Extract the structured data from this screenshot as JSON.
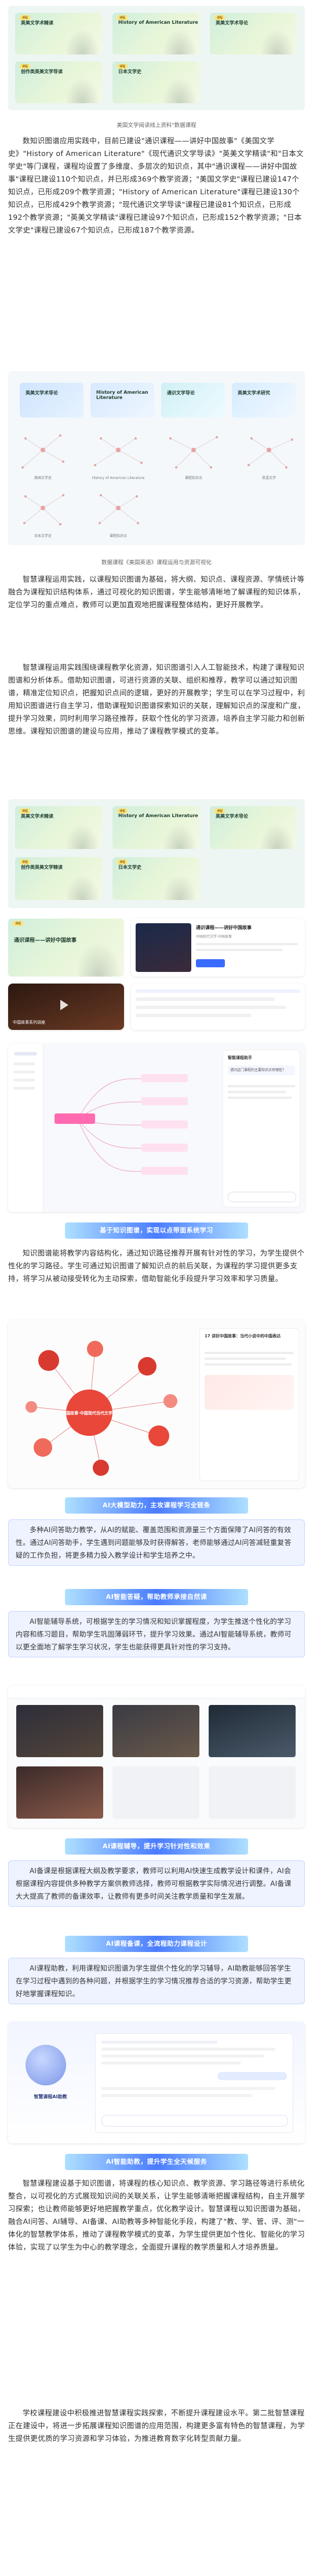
{
  "captions": {
    "c1": "美国文学阅读线上资料\"数据课程",
    "c2": "数据课程《美国英语》课程运用与资源可视化"
  },
  "tiles": {
    "grid1": [
      "英美文学术精读",
      "History of American Literature",
      "英美文学术导论",
      "创作类英美文学导读",
      "日本文学史"
    ],
    "grid2": [
      "英美文学术导论",
      "History of American Literature",
      "通识文学导论",
      "英美文学术研究"
    ],
    "grid3": [
      "英美文学术精读",
      "History of American Literature",
      "英美文学术导论",
      "创作类英美文学精读",
      "日本文学史"
    ],
    "big_left_title": "通识课程——讲好中国故事",
    "pill": "课程",
    "graph_labels": [
      "美国文学史",
      "History of American Literature",
      "课程知识点",
      "英语文学",
      "日本文学史"
    ]
  },
  "paragraphs": {
    "p1": "数知识图谱应用实践中，目前已建设\"通识课程——讲好中国故事\"《美国文学史》\"History of American Literature\"《现代通识文学导读》\"英美文学精读\"和\"日本文学史\"等门课程，课程均设置了多维度、多层次的知识点，其中\"通识课程——讲好中国故事\"课程已建设110个知识点，并已形成369个教学资源；\"美国文学史\"课程已建设147个知识点，已形成209个教学资源；\"History of American Literature\"课程已建设130个知识点，已形成429个教学资源；\"现代通识文学导读\"课程已建设81个知识点，已形成192个教学资源；\"英美文学精读\"课程已建设97个知识点，已形成152个教学资源；\"日本文学史\"课程已建设67个知识点，已形成187个教学资源。",
    "p2": "智慧课程运用实践，以课程知识图谱为基础，将大纲、知识点、课程资源、学情统计等融合为课程知识结构体系，通过可视化的知识图谱，学生能够清晰地了解课程的知识体系，定位学习的重点难点，教师可以更加直观地把握课程整体结构，更好开展教学。",
    "p3": "智慧课程运用实践围绕课程教学化资源，知识图谱引入人工智能技术，构建了课程知识图谱和分析体系。借助知识图谱，可进行资源的关联、组织和推荐，教学可以通过知识图谱，精准定位知识点，把握知识点间的逻辑，更好的开展教学；学生可以在学习过程中，利用知识图谱进行自主学习，借助课程知识图谱探索知识的关联，理解知识点的深度和广度，提升学习效果，同时利用学习路径推荐，获取个性化的学习资源，培养自主学习能力和创新思维。课程知识图谱的建设与应用，推动了课程教学模式的变革。",
    "p4": "知识图谱能将教学内容结构化，通过知识路径推荐开展有针对性的学习，为学生提供个性化的学习路径。学生可通过知识图谱了解知识点的前后关联，为课程的学习提供更多支持，将学习从被动接受转化为主动探索，借助智能化手段提升学习效率和学习质量。",
    "p5": "多种AI问答助力教学，从AI的赋能、覆盖范围和资源量三个方面保障了AI问答的有效性。通过AI问答助手，学生遇到问题能够及时获得解答，老师能够通过AI问答减轻重复答疑的工作负担，将更多精力投入教学设计和学生培养之中。",
    "p6": "AI智能辅导系统，可根据学生的学习情况和知识掌握程度，为学生推送个性化的学习内容和练习题目，帮助学生巩固薄弱环节，提升学习效果。通过AI智能辅导系统，教师可以更全面地了解学生学习状况，学生也能获得更具针对性的学习支持。",
    "p7": "AI备课是根据课程大纲及教学要求，教师可以利用AI快速生成教学设计和课件，AI会根据课程内容提供多种教学方案供教师选择，教师可根据教学实际情况进行调整。AI备课大大提高了教师的备课效率，让教师有更多时间关注教学质量和学生发展。",
    "p8": "AI课程助教，利用课程知识图谱为学生提供个性化的学习辅导，AI助教能够回答学生在学习过程中遇到的各种问题，并根据学生的学习情况推荐合适的学习资源，帮助学生更好地掌握课程知识。",
    "p9": "智慧课程建设基于知识图谱，将课程的核心知识点、教学资源、学习路径等进行系统化整合，以可视化的方式展现知识间的关联关系，让学生能够清晰把握课程结构，自主开展学习探索；也让教师能够更好地把握教学重点，优化教学设计。智慧课程以知识图谱为基础，融合AI问答、AI辅导、AI备课、AI助教等多种智能化手段，构建了\"教、学、管、评、测\"一体化的智慧教学体系，推动了课程教学模式的变革，为学生提供更加个性化、智能化的学习体验，实现了以学生为中心的教学理念，全面提升课程的教学质量和人才培养质量。",
    "p10": "学校课程建设中积极推进智慧课程实践探索，不断提升课程建设水平。第二批智慧课程正在建设中，将进一步拓展课程知识图谱的应用范围，构建更多富有特色的智慧课程，为学生提供更优质的学习资源和学习体验，为推进教育数字化转型贡献力量。"
  },
  "section_titles": {
    "s1": "基于知识图谱，实现以点带面系统学习",
    "s2": "AI大模型助力，主攻课程学习全链条",
    "s3": "AI智能答疑，帮助教师承接自然课",
    "s4": "AI课程辅导，提升学习针对性和效果",
    "s5": "AI课程备课，全流程助力课程设计",
    "s6": "AI智能助教，提升学生全天候服务"
  },
  "shots": {
    "course_header": "通识课程——讲好中国故事",
    "course_sub": "中国现代文学·中国故事",
    "chat_user": "智能课程助手",
    "chat_prompt": "请问这门课程的主要知识点有哪些？",
    "video_caption": "中国故事系列讲座",
    "kg_center": "国故事·中国现代当代文学",
    "kg_right_title": "17 讲好中国故事：当代小说中的中国表达",
    "assistant_title": "智慧课程AI助教"
  }
}
